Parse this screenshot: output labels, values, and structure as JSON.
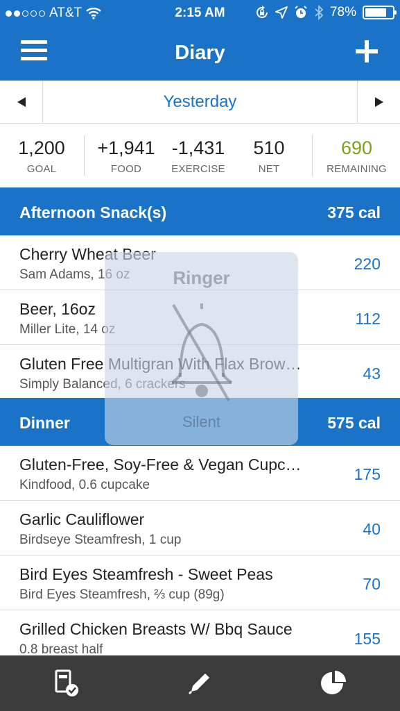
{
  "status_bar": {
    "carrier": "AT&T",
    "time": "2:15 AM",
    "battery": "78%",
    "battery_level": 0.78,
    "signal_bars_filled": 2,
    "signal_bars_total": 5,
    "icons": [
      "wifi-icon",
      "rotation-lock-icon",
      "location-icon",
      "alarm-icon",
      "bluetooth-icon",
      "battery-icon"
    ]
  },
  "nav": {
    "title": "Diary",
    "menu_icon": "hamburger-icon",
    "add_icon": "plus-icon"
  },
  "date_nav": {
    "label": "Yesterday",
    "prev_icon": "triangle-left-icon",
    "next_icon": "triangle-right-icon"
  },
  "summary": {
    "goal": {
      "value": "1,200",
      "label": "GOAL"
    },
    "food": {
      "value": "+1,941",
      "label": "FOOD"
    },
    "exercise": {
      "value": "-1,431",
      "label": "EXERCISE"
    },
    "net": {
      "value": "510",
      "label": "NET"
    },
    "remaining": {
      "value": "690",
      "label": "REMAINING",
      "color": "#7aa21a"
    }
  },
  "sections": [
    {
      "name": "Afternoon Snack(s)",
      "calories": "375 cal",
      "entries": [
        {
          "name": "Cherry Wheat Beer",
          "desc": "Sam Adams, 16 oz",
          "cal": "220"
        },
        {
          "name": "Beer, 16oz",
          "desc": "Miller Lite, 14 oz",
          "cal": "112"
        },
        {
          "name": "Gluten Free Multigran With Flax Brow…",
          "desc": "Simply Balanced, 6 crackers",
          "cal": "43"
        }
      ]
    },
    {
      "name": "Dinner",
      "calories": "575 cal",
      "entries": [
        {
          "name": "Gluten-Free, Soy-Free & Vegan Cupc…",
          "desc": "Kindfood, 0.6 cupcake",
          "cal": "175"
        },
        {
          "name": "Garlic Cauliflower",
          "desc": "Birdseye Steamfresh, 1 cup",
          "cal": "40"
        },
        {
          "name": "Bird Eyes Steamfresh - Sweet Peas",
          "desc": "Bird Eyes Steamfresh, ⅔ cup (89g)",
          "cal": "70"
        },
        {
          "name": "Grilled Chicken Breasts W/ Bbq Sauce",
          "desc": "0.8 breast half",
          "cal": "155"
        }
      ]
    }
  ],
  "ringer_overlay": {
    "title": "Ringer",
    "status": "Silent",
    "icon": "bell-slash-icon"
  },
  "tab_bar": {
    "icons": [
      "diary-icon",
      "pencil-icon",
      "pie-chart-icon"
    ]
  },
  "colors": {
    "brand_blue": "#1a73c7",
    "tab_bar": "#3b3b3b",
    "remaining_green": "#7aa21a"
  }
}
